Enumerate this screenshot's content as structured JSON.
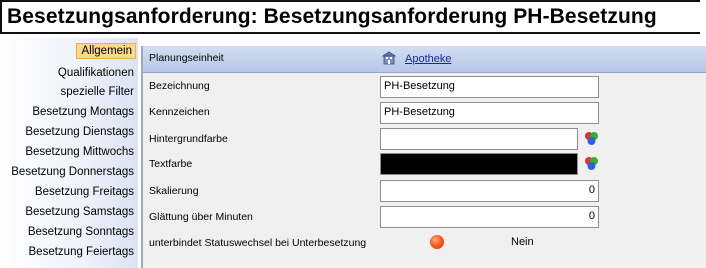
{
  "window": {
    "title": "Besetzungsanforderung: Besetzungsanforderung PH-Besetzung"
  },
  "nav": {
    "items": [
      "Allgemein",
      "Qualifikationen",
      "spezielle Filter",
      "Besetzung Montags",
      "Besetzung Dienstags",
      "Besetzung Mittwochs",
      "Besetzung Donnerstags",
      "Besetzung Freitags",
      "Besetzung Samstags",
      "Besetzung Sonntags",
      "Besetzung Feiertags"
    ],
    "active": "Allgemein"
  },
  "form": {
    "planungseinheit": {
      "label": "Planungseinheit",
      "value": "Apotheke",
      "icon": "building-icon"
    },
    "bezeichnung": {
      "label": "Bezeichnung",
      "value": "PH-Besetzung"
    },
    "kennzeichen": {
      "label": "Kennzeichen",
      "value": "PH-Besetzung"
    },
    "hintergrundfarbe": {
      "label": "Hintergrundfarbe",
      "value": "",
      "color": "#ffffff",
      "icon": "color-picker-icon"
    },
    "textfarbe": {
      "label": "Textfarbe",
      "value": "",
      "color": "#000000",
      "icon": "color-picker-icon"
    },
    "skalierung": {
      "label": "Skalierung",
      "value": "0"
    },
    "glaettung": {
      "label": "Glättung über Minuten",
      "value": "0"
    },
    "statuswechsel": {
      "label": "unterbindet Statuswechsel bei Unterbesetzung",
      "value": "Nein",
      "indicator_color": "#ff5a1a"
    }
  }
}
